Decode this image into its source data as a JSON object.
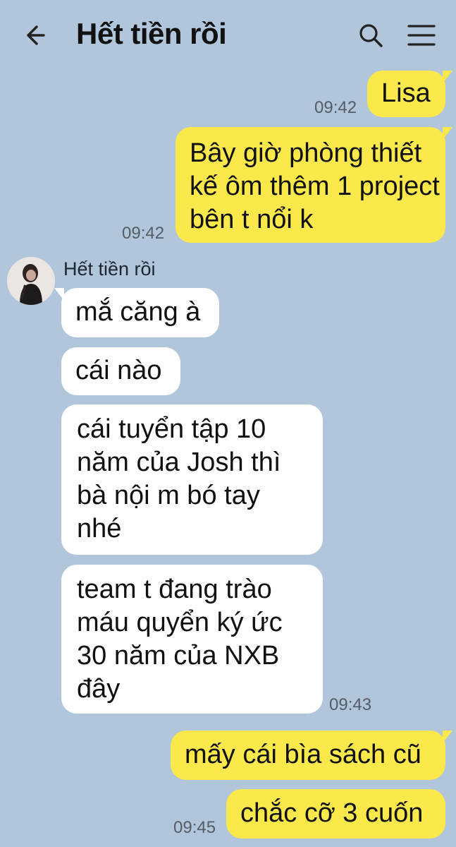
{
  "header": {
    "title": "Hết tiền rồi",
    "back_icon": "arrow-left-icon",
    "search_icon": "search-icon",
    "menu_icon": "hamburger-menu-icon"
  },
  "colors": {
    "background": "#b1c6da",
    "outgoing_bubble": "#fbe84b",
    "incoming_bubble": "#ffffff"
  },
  "messages": [
    {
      "direction": "outgoing",
      "text": "Lisa",
      "time": "09:42"
    },
    {
      "direction": "outgoing",
      "text": "Bây giờ phòng thiết kế ôm thêm 1 project bên t nổi k",
      "time": "09:42"
    },
    {
      "direction": "incoming",
      "sender": "Hết tiền rồi",
      "text": "mắ căng à"
    },
    {
      "direction": "incoming",
      "text": "cái nào"
    },
    {
      "direction": "incoming",
      "text": "cái tuyển tập 10 năm của Josh thì bà nội m bó tay nhé"
    },
    {
      "direction": "incoming",
      "text": "team t đang trào máu quyển ký ức 30 năm của NXB đây",
      "time": "09:43"
    },
    {
      "direction": "outgoing",
      "text": "mấy cái bìa sách cũ"
    },
    {
      "direction": "outgoing",
      "text": "chắc cỡ 3 cuốn",
      "time": "09:45"
    }
  ]
}
